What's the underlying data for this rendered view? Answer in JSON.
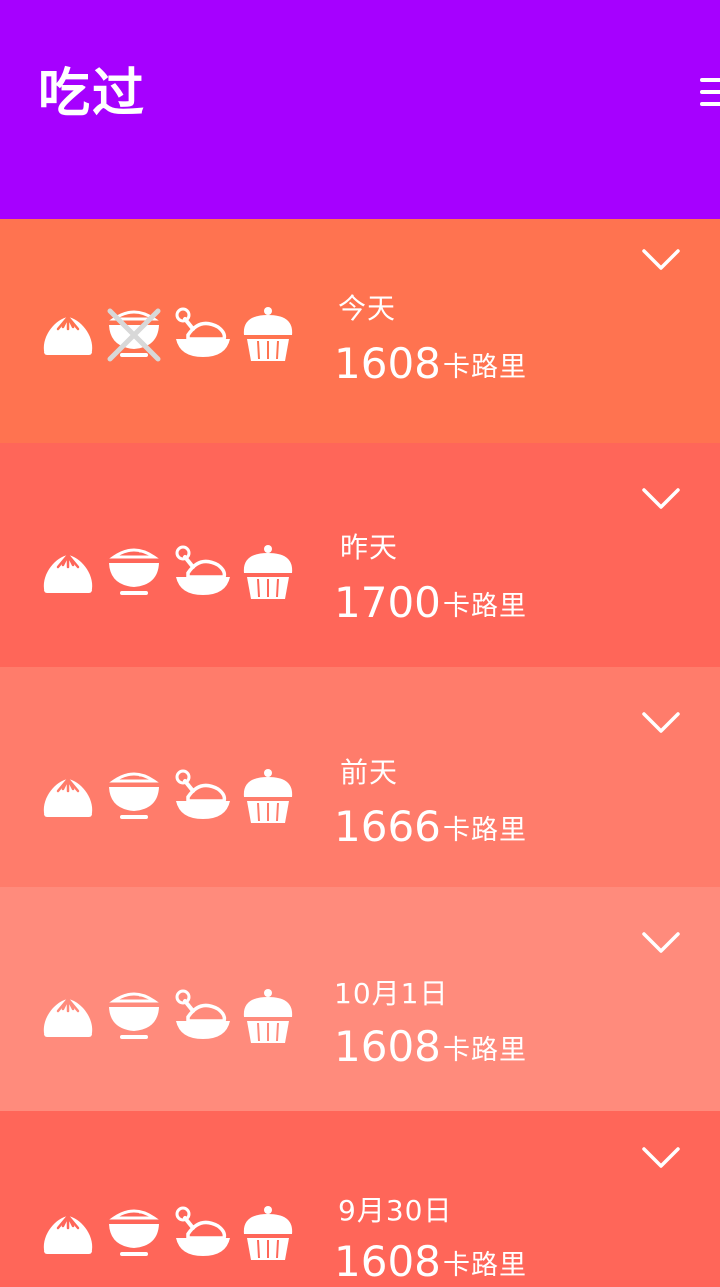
{
  "app": {
    "title": "吃过",
    "menu_icon": "menu-icon"
  },
  "colors": {
    "header": "#a600ff",
    "rows": [
      "#ff7350",
      "#ff6659",
      "#ff7c6b",
      "#ff8b7c",
      "#ff6659"
    ]
  },
  "days": [
    {
      "label": "今天",
      "calories": "1608",
      "unit": "卡路里",
      "meals": [
        "bun",
        "rice-crossed",
        "chicken",
        "cupcake"
      ]
    },
    {
      "label": "昨天",
      "calories": "1700",
      "unit": "卡路里",
      "meals": [
        "bun",
        "rice",
        "chicken",
        "cupcake"
      ]
    },
    {
      "label": "前天",
      "calories": "1666",
      "unit": "卡路里",
      "meals": [
        "bun",
        "rice",
        "chicken",
        "cupcake"
      ]
    },
    {
      "label": "10月1日",
      "calories": "1608",
      "unit": "卡路里",
      "meals": [
        "bun",
        "rice",
        "chicken",
        "cupcake"
      ]
    },
    {
      "label": "9月30日",
      "calories": "1608",
      "unit": "卡路里",
      "meals": [
        "bun",
        "rice",
        "chicken",
        "cupcake"
      ]
    }
  ]
}
